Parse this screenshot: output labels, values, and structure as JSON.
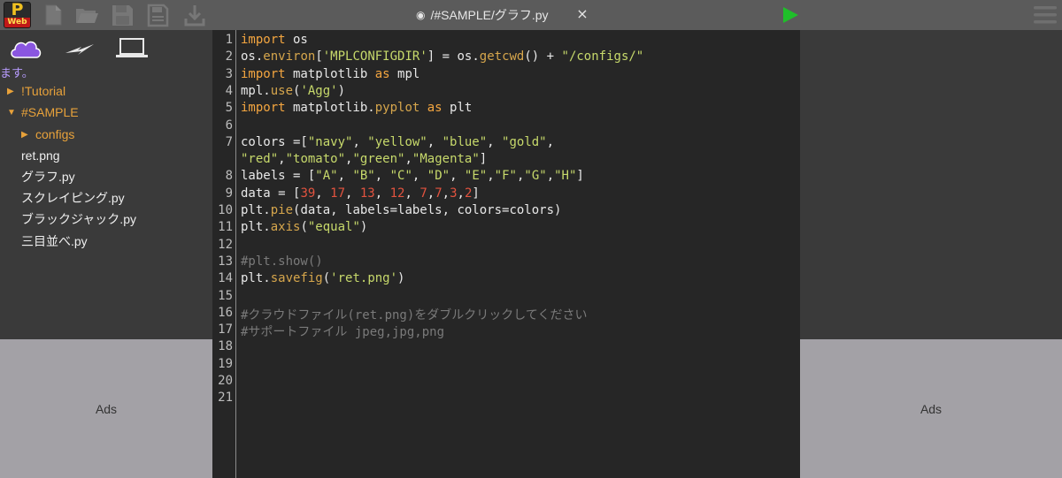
{
  "toolbar": {
    "logo_top": "P",
    "logo_bottom": "Web",
    "file_title": "/#SAMPLE/グラフ.py",
    "close": "×"
  },
  "sidebar": {
    "message": "ます。",
    "tree": [
      {
        "label": "!Tutorial",
        "type": "folder",
        "expanded": false
      },
      {
        "label": "#SAMPLE",
        "type": "folder",
        "expanded": true
      },
      {
        "label": "configs",
        "type": "folder",
        "expanded": false
      },
      {
        "label": "ret.png",
        "type": "file"
      },
      {
        "label": "グラフ.py",
        "type": "file"
      },
      {
        "label": "スクレイピング.py",
        "type": "file"
      },
      {
        "label": "ブラックジャック.py",
        "type": "file"
      },
      {
        "label": "三目並べ.py",
        "type": "file"
      }
    ]
  },
  "ads": {
    "left": "Ads",
    "right": "Ads"
  },
  "editor": {
    "line_numbers": [
      "1",
      "2",
      "3",
      "4",
      "5",
      "6",
      "7",
      "",
      "8",
      "9",
      "10",
      "11",
      "12",
      "13",
      "14",
      "15",
      "16",
      "17",
      "18",
      "19",
      "20",
      "21"
    ],
    "lines": [
      "import os",
      "os.environ['MPLCONFIGDIR'] = os.getcwd() + \"/configs/\"",
      "import matplotlib as mpl",
      "mpl.use('Agg')",
      "import matplotlib.pyplot as plt",
      "",
      "colors =[\"navy\", \"yellow\", \"blue\", \"gold\",",
      "\"red\",\"tomato\",\"green\",\"Magenta\"]",
      "labels = [\"A\", \"B\", \"C\", \"D\", \"E\",\"F\",\"G\",\"H\"]",
      "data = [39, 17, 13, 12, 7,7,3,2]",
      "plt.pie(data, labels=labels, colors=colors)",
      "plt.axis(\"equal\")",
      "",
      "#plt.show()",
      "plt.savefig('ret.png')",
      "",
      "#クラウドファイル(ret.png)をダブルクリックしてください",
      "#サポートファイル jpeg,jpg,png",
      "",
      "",
      "",
      ""
    ]
  },
  "colors": {
    "toolbar_bg": "#5b5b5b",
    "panel_bg": "#3a3a3a",
    "editor_bg": "#262626",
    "folder": "#e8a23a",
    "keyword": "#f4a640",
    "string": "#c7d96b",
    "number": "#e2533f",
    "comment": "#7a7a7a",
    "run": "#1fbf2a",
    "cloud": "#8a56e0",
    "message": "#b89cff",
    "ads_bg": "#a3a1a6"
  },
  "icons": [
    "new-file-icon",
    "open-folder-icon",
    "save-icon",
    "save-as-icon",
    "download-icon",
    "run-icon",
    "hamburger-menu-icon",
    "cloud-icon",
    "lightning-icon",
    "laptop-icon"
  ]
}
